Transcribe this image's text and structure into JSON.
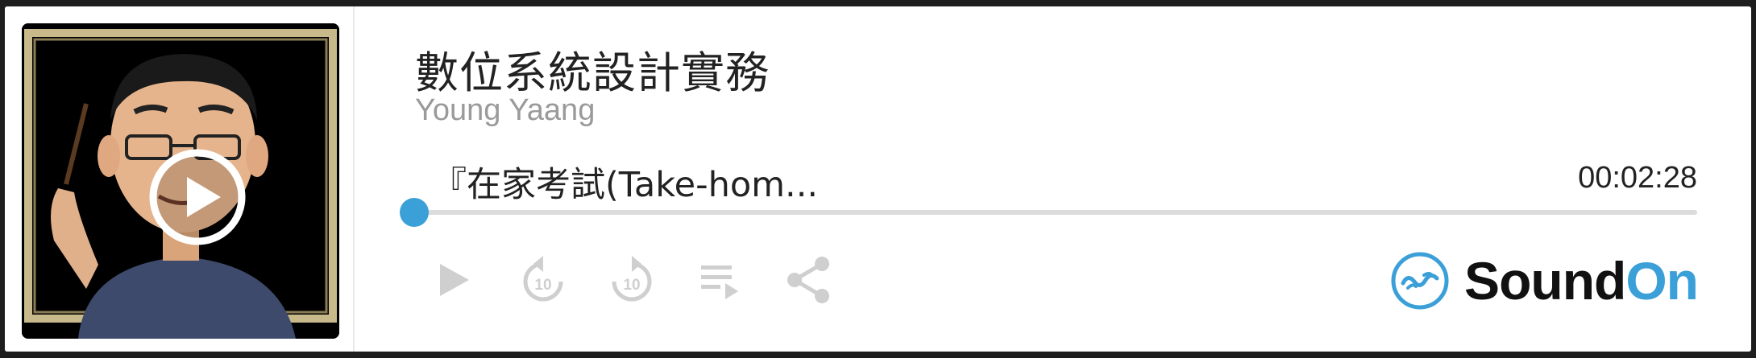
{
  "podcast": {
    "title": "數位系統設計實務",
    "author": "Young Yaang"
  },
  "episode": {
    "title": "『在家考試(Take-hom...",
    "duration": "00:02:28",
    "progress_fraction": 0.0
  },
  "controls": [
    {
      "name": "play-icon"
    },
    {
      "name": "rewind-10-icon",
      "label": "10"
    },
    {
      "name": "forward-10-icon",
      "label": "10"
    },
    {
      "name": "playlist-icon"
    },
    {
      "name": "share-icon"
    }
  ],
  "brand": {
    "sound": "Sound",
    "on": "On",
    "accent_color": "#3b9fd8"
  },
  "colors": {
    "accent": "#3b9fd8",
    "control_gray": "#cfcfcf",
    "author_gray": "#9a9a9a"
  }
}
